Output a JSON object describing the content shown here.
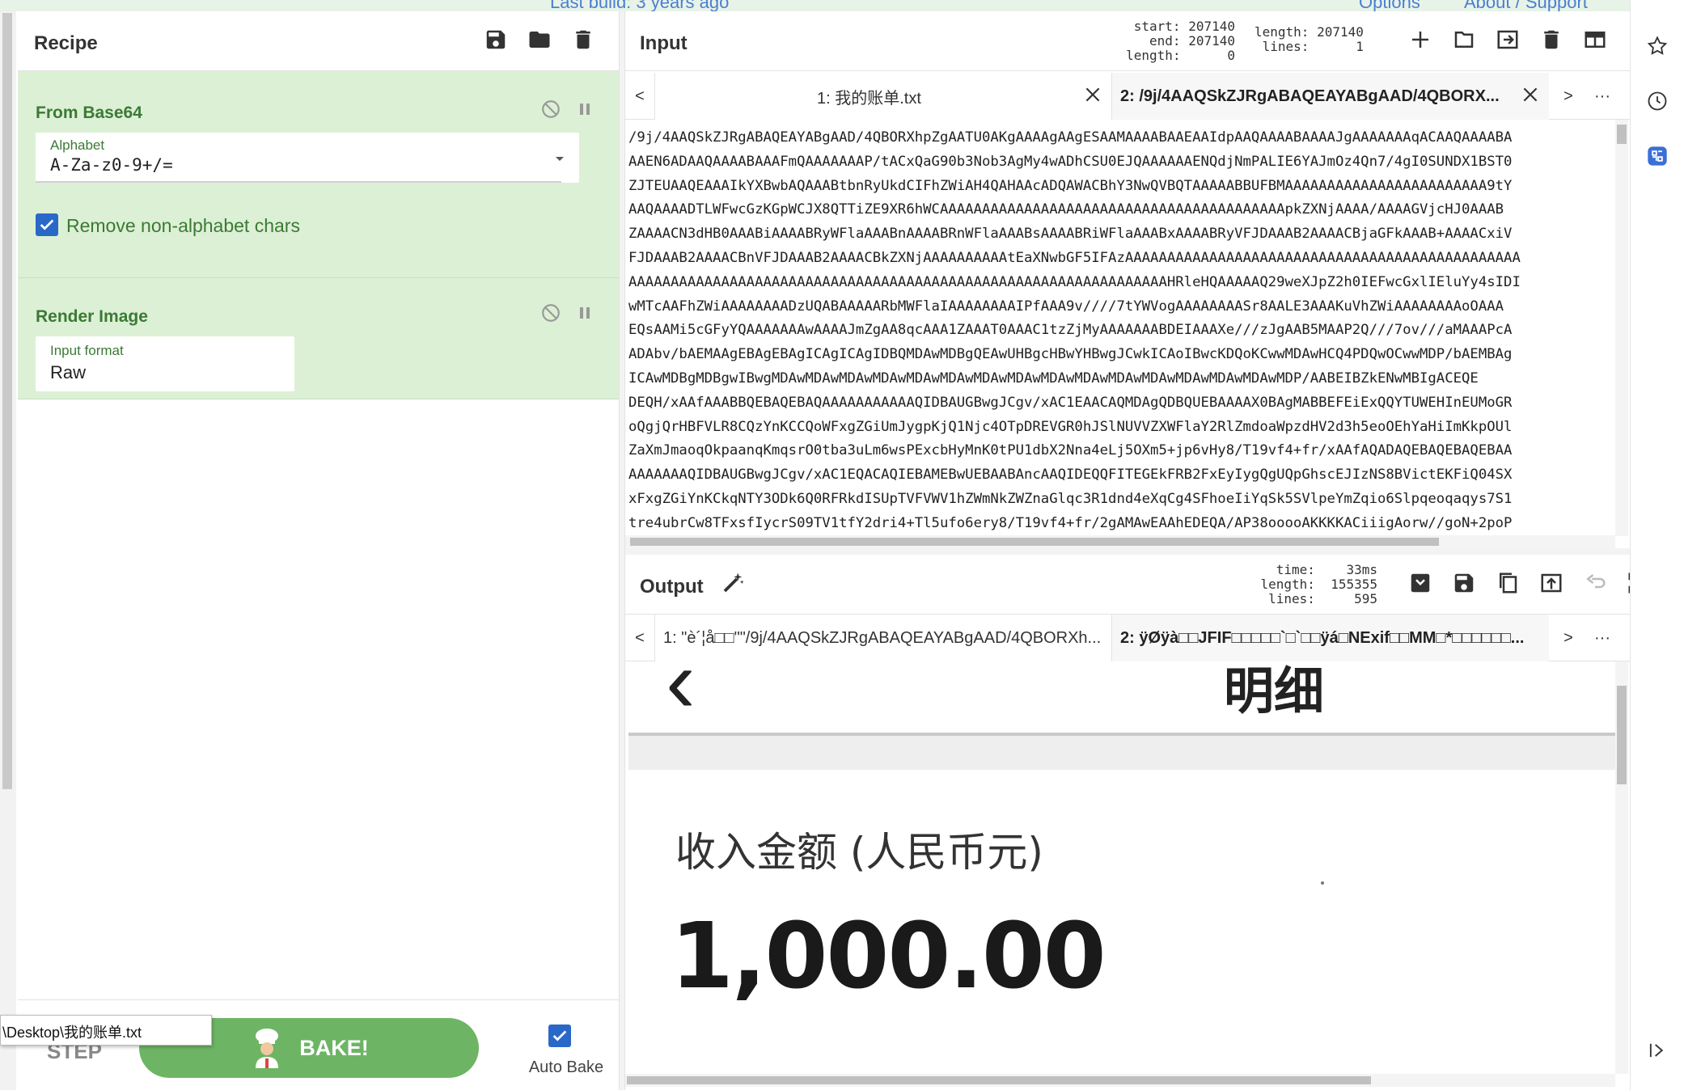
{
  "top_strip": {
    "left_text": "Last build: 3 years ago",
    "options": "Options",
    "about": "About / Support"
  },
  "recipe": {
    "title": "Recipe",
    "operations": [
      {
        "name": "From Base64",
        "alphabet_label": "Alphabet",
        "alphabet_value": "A-Za-z0-9+/=",
        "checkbox_label": "Remove non-alphabet chars",
        "checked": true
      },
      {
        "name": "Render Image",
        "format_label": "Input format",
        "format_value": "Raw"
      }
    ],
    "step_label": "STEP",
    "bake_label": "BAKE!",
    "autobake_label": "Auto Bake",
    "tooltip": "\\Desktop\\我的账单.txt"
  },
  "input": {
    "title": "Input",
    "stats_left": "start: 207140\n  end: 207140\nlength:      0",
    "stats_right": "length: 207140\n lines:      1",
    "tab1": "1: 我的账单.txt",
    "tab2": "2: /9j/4AAQSkZJRgABAQEAYABgAAD/4QBORX...",
    "prev": "<",
    "next": ">",
    "more": "···",
    "lines": [
      "/9j/4AAQSkZJRgABAQEAYABgAAD/4QBORXhpZgAATU0AKgAAAAgAAgESAAMAAAABAAEAAIdpAAQAAAABAAAAJgAAAAAAAqACAAQAAAABA",
      "AAEN6ADAAQAAAABAAAFmQAAAAAAAP/tACxQaG90b3Nob3AgMy4wADhCSU0EJQAAAAAAENQdjNmPALIE6YAJmOz4Qn7/4gI0SUNDX1BST0",
      "ZJTEUAAQEAAAIkYXBwbAQAAABtbnRyUkdCIFhZWiAH4QAHAAcADQAWACBhY3NwQVBQTAAAAABBUFBMAAAAAAAAAAAAAAAAAAAAAAAA9tY",
      "AAQAAAADTLWFwcGzKGpWCJX8QTTiZE9XR6hWCAAAAAAAAAAAAAAAAAAAAAAAAAAAAAAAAAAAAAAAAApkZXNjAAAA/AAAAGVjcHJ0AAAB",
      "ZAAAACN3dHB0AAABiAAAABRyWFlaAAABnAAAABRnWFlaAAABsAAAABRiWFlaAAABxAAAABRyVFJDAAAB2AAAACBjaGFkAAAB+AAAACxiV",
      "FJDAAAB2AAAACBnVFJDAAAB2AAAACBkZXNjAAAAAAAAAAtEaXNwbGF5IFAzAAAAAAAAAAAAAAAAAAAAAAAAAAAAAAAAAAAAAAAAAAAAAAA",
      "AAAAAAAAAAAAAAAAAAAAAAAAAAAAAAAAAAAAAAAAAAAAAAAAAAAAAAAAAAAAAAAAHRleHQAAAAAQ29weXJpZ2h0IEFwcGxlIEluYy4sIDI",
      "wMTcAAFhZWiAAAAAAAADzUQABAAAAARbMWFlaIAAAAAAAAIPfAAA9v////7tYWVogAAAAAAAASr8AALE3AAAKuVhZWiAAAAAAAAoOAAA",
      "EQsAAMi5cGFyYQAAAAAAAwAAAAJmZgAA8qcAAA1ZAAAT0AAAC1tzZjMyAAAAAAABDEIAAAXe///zJgAAB5MAAP2Q///7ov///aMAAAPcA",
      "ADAbv/bAEMAAgEBAgEBAgICAgICAgIDBQMDAwMDBgQEAwUHBgcHBwYHBwgJCwkICAoIBwcKDQoKCwwMDAwHCQ4PDQwOCwwMDP/bAEMBAg",
      "ICAwMDBgMDBgwIBwgMDAwMDAwMDAwMDAwMDAwMDAwMDAwMDAwMDAwMDAwMDAwMDAwMDAwMDAwMDAwMDP/AABEIBZkENwMBIgACEQE",
      "DEQH/xAAfAAABBQEBAQEBAQAAAAAAAAAAAQIDBAUGBwgJCgv/xAC1EAACAQMDAgQDBQUEBAAAAX0BAgMABBEFEiExQQYTUWEHInEUMoGR",
      "oQgjQrHBFVLR8CQzYnKCCQoWFxgZGiUmJygpKjQ1Njc4OTpDREVGR0hJSlNUVVZXWFlaY2RlZmdoaWpzdHV2d3h5eoOEhYaHiImKkpOUl",
      "ZaXmJmaoqOkpaanqKmqsrO0tba3uLm6wsPExcbHyMnK0tPU1dbX2Nna4eLj5OXm5+jp6vHy8/T19vf4+fr/xAAfAQADAQEBAQEBAQEBAA",
      "AAAAAAAQIDBAUGBwgJCgv/xAC1EQACAQIEBAMEBwUEBAABAncAAQIDEQQFITEGEkFRB2FxEyIygQgUQpGhscEJIzNS8BVictEKFiQ04SX",
      "xFxgZGiYnKCkqNTY3ODk6Q0RFRkdISUpTVFVWV1hZWmNkZWZnaGlqc3R1dnd4eXqCg4SFhoeIiYqSk5SVlpeYmZqio6Slpqeoqaqys7S1",
      "tre4ubrCw8TFxsfIycrS09TV1tfY2dri4+Tl5ufo6ery8/T19vf4+fr/2gAMAwEAAhEDEQA/AP38ooooAKKKKACiiigAorw//goN+2poP"
    ]
  },
  "output": {
    "title": "Output",
    "stats": "  time:    33ms\nlength:  155355\n lines:     595",
    "tab1": "1: \"è´¦å□□\"\"/9j/4AAQSkZJRgABAQEAYABgAAD/4QBORXh...",
    "tab2": "2: ÿØÿà□□JFIF□□□□□`□`□□ÿá□NExif□□MM□*□□□□□□...",
    "prev": "<",
    "next": ">",
    "more": "···",
    "image": {
      "back_glyph": "‹",
      "header_title": "明细",
      "income_label": "收入金额 (人民币元)",
      "amount": "1,000.00"
    }
  },
  "colors": {
    "op_bg": "#dcf0d5",
    "op_text": "#3b7a35",
    "bake": "#6db565",
    "checkbox": "#2a68c8"
  }
}
